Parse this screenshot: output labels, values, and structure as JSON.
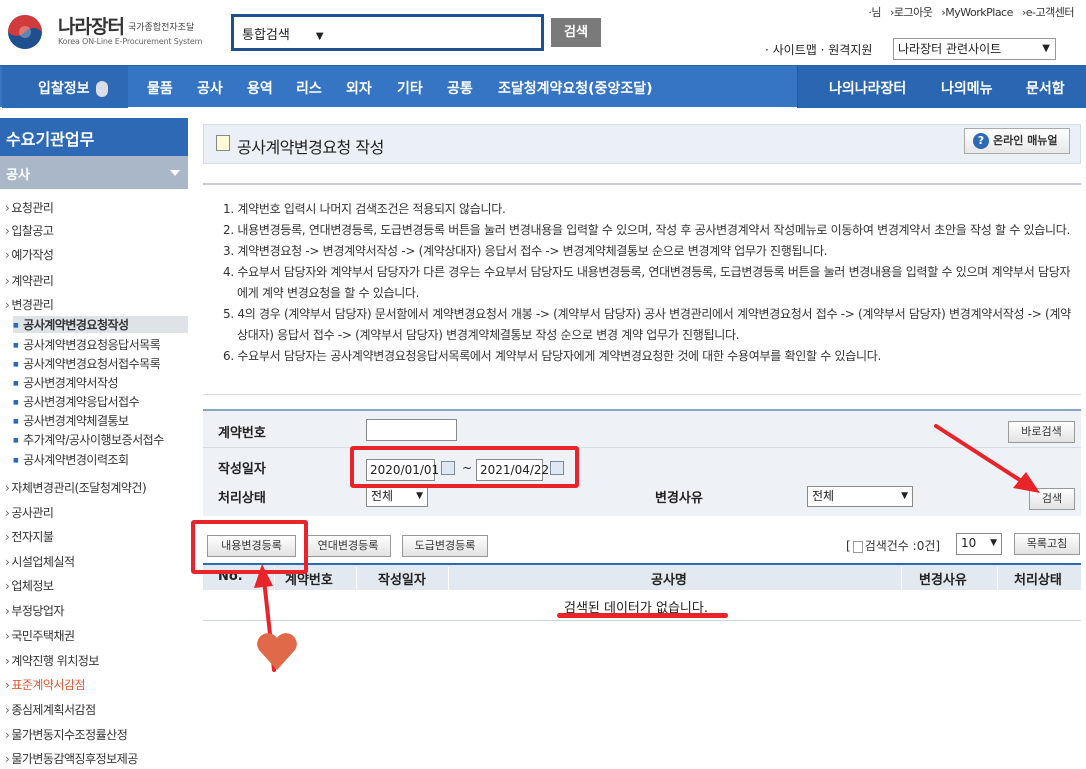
{
  "header": {
    "logo_title": "나라장터",
    "logo_sub": "국가종합전자조달",
    "logo_en": "Korea ON-Line E-Procurement System",
    "search_select": "통합검색",
    "search_button": "검색",
    "toplinks": [
      "·님",
      "›로그아웃",
      "›MyWorkPlace",
      "›e-고객센터"
    ],
    "sitemap": "· 사이트맵 · 원격지원",
    "related_select": "나라장터 관련사이트"
  },
  "nav": {
    "items": [
      "입찰정보",
      "물품",
      "공사",
      "용역",
      "리스",
      "외자",
      "기타",
      "공통",
      "조달청계약요청(중앙조달)"
    ],
    "right_items": [
      "나의나라장터",
      "나의메뉴",
      "문서함"
    ]
  },
  "sidebar": {
    "header": "수요기관업무",
    "section": "공사",
    "items_top": [
      "요청관리",
      "입찰공고",
      "예가작성",
      "계약관리",
      "변경관리"
    ],
    "sub_items": [
      "공사계약변경요청작성",
      "공사계약변경요청응답서목록",
      "공사계약변경요청서접수목록",
      "공사변경계약서작성",
      "공사변경계약응답서접수",
      "공사변경계약체결통보",
      "추가계약/공사이행보증서접수",
      "공사계약변경이력조회"
    ],
    "items_bottom": [
      "자체변경관리(조달청계약건)",
      "공사관리",
      "전자지불",
      "시설업체실적",
      "업체정보",
      "부정당업자",
      "국민주택채권",
      "계약진행 위치정보",
      "표준계약서감점",
      "종심제계획서감점",
      "물가변동지수조정률산정",
      "물가변동감액징후정보제공"
    ]
  },
  "page": {
    "title": "공사계약변경요청 작성",
    "manual_button": "온라인 매뉴얼",
    "notices": [
      "1. 계약번호 입력시 나머지 검색조건은 적용되지 않습니다.",
      "2. 내용변경등록, 연대변경등록, 도급변경등록 버튼을 눌러 변경내용을 입력할 수 있으며, 작성 후 공사변경계약서 작성메뉴로 이동하여 변경계약서 초안을 작성 할 수 있습니다.",
      "3. 계약변경요청 -> 변경계약서작성 -> (계약상대자) 응답서 접수 -> 변경계약체결통보 순으로 변경계약 업무가 진행됩니다.",
      "4. 수요부서 담당자와 계약부서 담당자가 다른 경우는 수요부서 담당자도 내용변경등록, 연대변경등록, 도급변경등록 버튼을 눌러 변경내용을 입력할 수 있으며 계약부서 담당자에게 계약 변경요청을 할 수 있습니다.",
      "5. 4의 경우 (계약부서 담당자) 문서함에서 계약변경요청서 개봉 -> (계약부서 담당자) 공사 변경관리에서 계약변경요청서 접수 -> (계약부서 담당자) 변경계약서작성 -> (계약상대자) 응답서 접수 -> (계약부서 담당자) 변경계약체결통보 작성 순으로 변경 계약 업무가 진행됩니다.",
      "6. 수요부서 담당자는 공사계약변경요청응답서목록에서 계약부서 담당자에게 계약변경요청한 것에 대한 수용여부를 확인할 수 있습니다."
    ]
  },
  "search": {
    "contract_no_label": "계약번호",
    "contract_no_value": "",
    "quick_search_button": "바로검색",
    "date_label": "작성일자",
    "date_from": "2020/01/01",
    "date_sep": "~",
    "date_to": "2021/04/22",
    "status_label": "처리상태",
    "status_value": "전체",
    "reason_label": "변경사유",
    "reason_value": "전체",
    "search_button": "검색"
  },
  "actions": {
    "content_change": "내용변경등록",
    "joint_change": "연대변경등록",
    "subcontract_change": "도급변경등록",
    "count_prefix": "[",
    "count_text": "검색건수 :0건]",
    "page_size": "10",
    "refresh_button": "목록고침"
  },
  "table": {
    "columns": [
      "No.",
      "계약번호",
      "작성일자",
      "공사명",
      "변경사유",
      "처리상태"
    ],
    "empty_message": "검색된 데이터가 없습니다."
  },
  "colors": {
    "nav_blue": "#3575c4",
    "annotation_red": "#e8232a",
    "heart": "#e0694a"
  }
}
